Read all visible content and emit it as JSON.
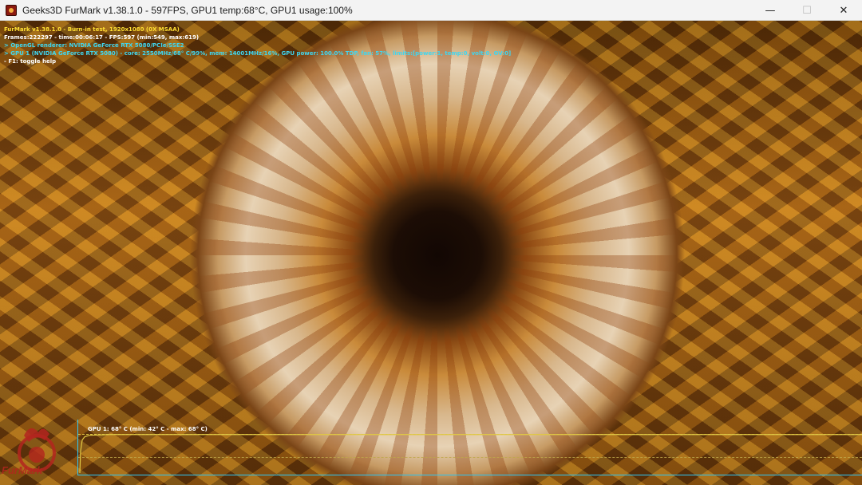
{
  "window": {
    "title": "Geeks3D FurMark v1.38.1.0 - 597FPS, GPU1 temp:68°C, GPU1 usage:100%",
    "controls": {
      "minimize": "—",
      "maximize": "☐",
      "close": "✕"
    }
  },
  "hud": {
    "line1": "FurMark v1.38.1.0 - Burn-in test, 1920x1080 (0X MSAA)",
    "line2": "Frames:222297 - time:00:06:17 - FPS:597 (min:549, max:619)",
    "line3": "> OpenGL renderer: NVIDIA GeForce RTX 5080/PCIe/SSE2",
    "line4": "> GPU 1 (NVIDIA GeForce RTX 5080) - core: 2550MHz/68° C/99%, mem: 14001MHz/16%, GPU power: 100.0% TDP, fan: 57%, limits:[power:1, temp:0, volt:0, OV:0]",
    "line5": "- F1: toggle help"
  },
  "graph": {
    "label": "GPU 1: 68° C (min: 42° C - max: 68° C)",
    "current_temp": 68,
    "min_temp": 42,
    "max_temp": 68
  },
  "logo": {
    "text": "FurMark"
  },
  "colors": {
    "hud_yellow": "#ffe033",
    "hud_cyan": "#3fd6f0",
    "graph_axis": "#2fc6f4",
    "graph_line": "#d9c040"
  }
}
